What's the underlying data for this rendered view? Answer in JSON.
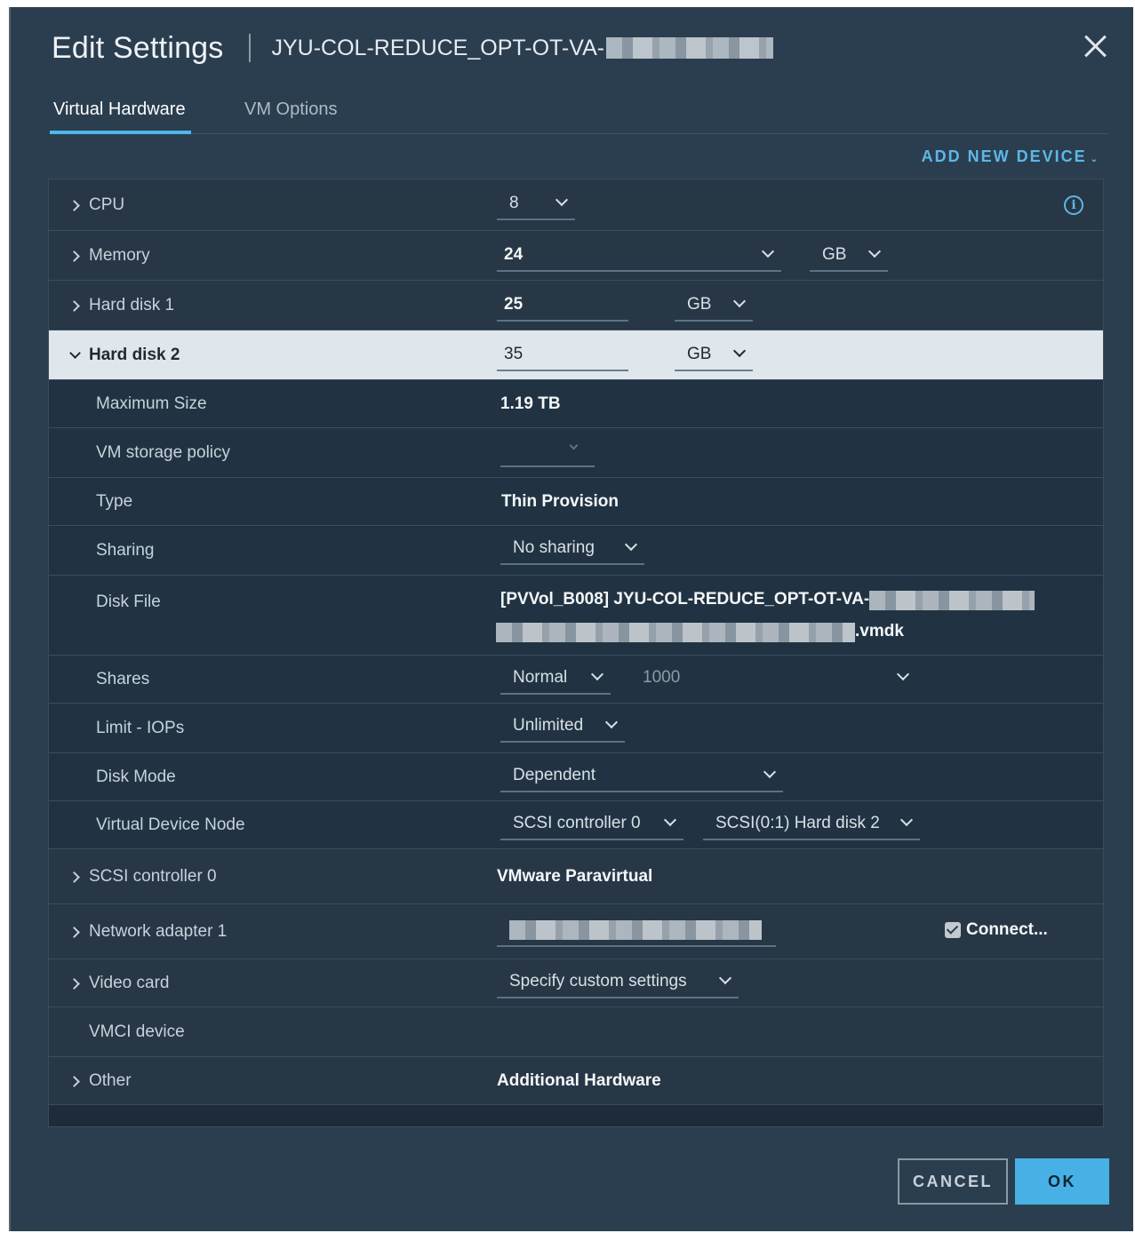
{
  "dialog": {
    "title": "Edit Settings",
    "vm_name": "JYU-COL-REDUCE_OPT-OT-VA-",
    "close_icon": "close-icon"
  },
  "tabs": [
    {
      "label": "Virtual Hardware",
      "active": true
    },
    {
      "label": "VM Options",
      "active": false
    }
  ],
  "add_new_device": "ADD NEW DEVICE",
  "hardware": {
    "cpu": {
      "label": "CPU",
      "value": "8"
    },
    "memory": {
      "label": "Memory",
      "value": "24",
      "unit": "GB"
    },
    "hard_disk_1": {
      "label": "Hard disk 1",
      "value": "25",
      "unit": "GB"
    },
    "hard_disk_2": {
      "label": "Hard disk 2",
      "value": "35",
      "unit": "GB",
      "maximum_size": {
        "label": "Maximum Size",
        "value": "1.19 TB"
      },
      "storage_policy": {
        "label": "VM storage policy",
        "value": ""
      },
      "type": {
        "label": "Type",
        "value": "Thin Provision"
      },
      "sharing": {
        "label": "Sharing",
        "value": "No sharing"
      },
      "disk_file": {
        "label": "Disk File",
        "line1": "[PVVol_B008] JYU-COL-REDUCE_OPT-OT-VA-",
        "line2_suffix": ".vmdk"
      },
      "shares": {
        "label": "Shares",
        "level": "Normal",
        "value": "1000"
      },
      "limit_iops": {
        "label": "Limit - IOPs",
        "value": "Unlimited"
      },
      "disk_mode": {
        "label": "Disk Mode",
        "value": "Dependent"
      },
      "virtual_device_node": {
        "label": "Virtual Device Node",
        "controller": "SCSI controller 0",
        "node": "SCSI(0:1) Hard disk 2"
      }
    },
    "scsi_controller": {
      "label": "SCSI controller 0",
      "value": "VMware Paravirtual"
    },
    "network_adapter": {
      "label": "Network adapter 1",
      "connect_label": "Connect...",
      "connected": true
    },
    "video_card": {
      "label": "Video card",
      "value": "Specify custom settings"
    },
    "vmci": {
      "label": "VMCI device"
    },
    "other": {
      "label": "Other",
      "value": "Additional Hardware"
    }
  },
  "footer": {
    "cancel": "CANCEL",
    "ok": "OK"
  },
  "colors": {
    "accent": "#47b1e6",
    "background": "#2b3e50",
    "selected_row": "#dfe6ec"
  }
}
